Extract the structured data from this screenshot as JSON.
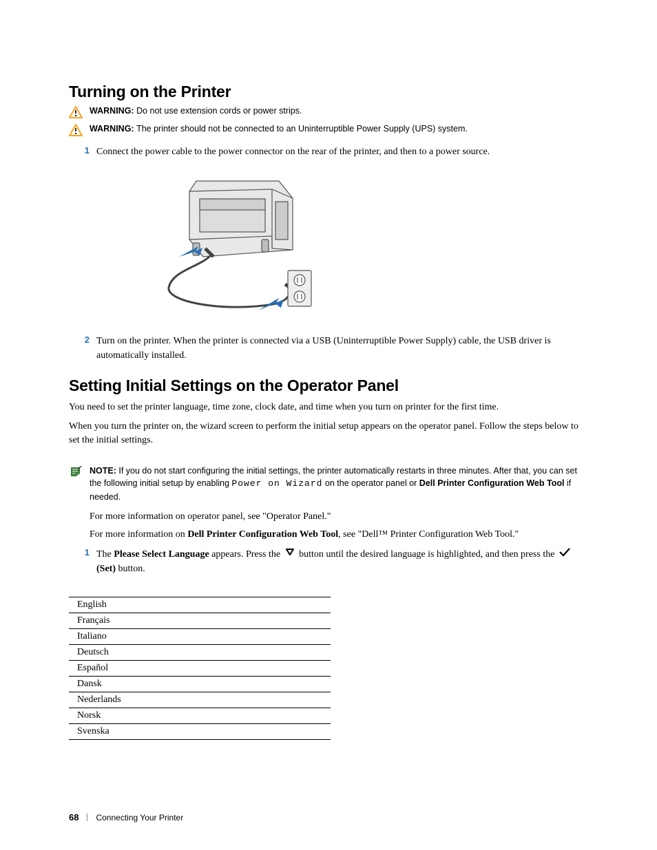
{
  "h2_1": "Turning on the Printer",
  "warn1": {
    "label": "WARNING: ",
    "text": "Do not use extension cords or power strips."
  },
  "warn2": {
    "label": "WARNING: ",
    "text": "The printer should not be connected to an Uninterruptible Power Supply (UPS) system."
  },
  "step1": {
    "num": "1",
    "text": "Connect the power cable to the power connector on the rear of the printer, and then to a power source."
  },
  "step2": {
    "num": "2",
    "text": "Turn on the printer. When the printer is connected via a USB (Uninterruptible Power Supply) cable, the USB driver is automatically installed."
  },
  "h2_2": "Setting Initial Settings on the Operator Panel",
  "intro1": "You need to set the printer language, time zone, clock date, and time when you turn on printer for the first time.",
  "intro2": "When you turn the printer on, the wizard screen to perform the initial setup appears on the operator panel. Follow the steps below to set the initial settings.",
  "note": {
    "label": "NOTE: ",
    "t1": "If you do not start configuring the initial settings, the printer automatically restarts in three minutes. After that, you can set the following initial setup by enabling ",
    "mono": "Power on Wizard",
    "t2": " on the operator panel or ",
    "bold": "Dell Printer Configuration Web Tool",
    "t3": " if needed."
  },
  "sub1": "For more information on operator panel, see \"Operator Panel.\"",
  "sub2": {
    "a": "For more information on ",
    "b": "Dell Printer Configuration Web Tool",
    "c": ", see \"Dell™ Printer Configuration Web Tool.\""
  },
  "step3": {
    "num": "1",
    "a": "The ",
    "b": "Please Select Language",
    "c": " appears. Press the ",
    "d": " button until the desired language is highlighted, and then press the ",
    "e": " (Set)",
    "f": " button."
  },
  "languages": [
    "English",
    "Français",
    "Italiano",
    "Deutsch",
    "Español",
    "Dansk",
    "Nederlands",
    "Norsk",
    "Svenska"
  ],
  "footer": {
    "page": "68",
    "section": "Connecting Your Printer"
  }
}
